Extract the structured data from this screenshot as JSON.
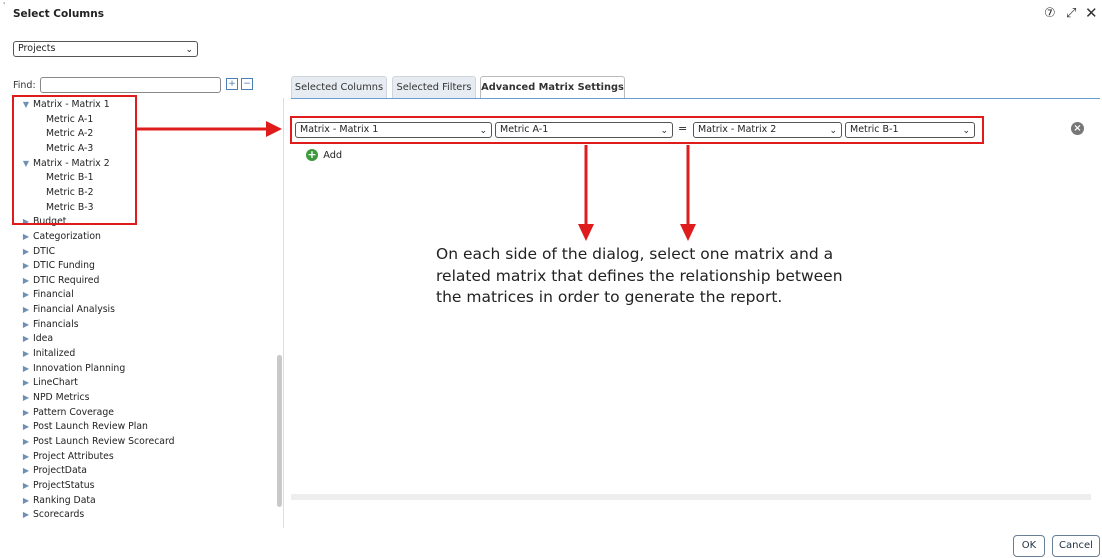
{
  "dialog": {
    "title": "Select Columns",
    "help_icon": "help-circle-icon",
    "expand_icon": "expand-icon",
    "close_icon": "close-icon",
    "help_glyph": "⑦",
    "expand_glyph": "⤢",
    "close_glyph": "✕"
  },
  "entity_select": {
    "value": "Projects"
  },
  "find": {
    "label": "Find:",
    "value": ""
  },
  "tree": {
    "items": [
      {
        "label": "Matrix - Matrix 1",
        "expanded": true,
        "level": 0
      },
      {
        "label": "Metric A-1",
        "level": 1
      },
      {
        "label": "Metric A-2",
        "level": 1
      },
      {
        "label": "Metric A-3",
        "level": 1
      },
      {
        "label": "Matrix - Matrix 2",
        "expanded": true,
        "level": 0
      },
      {
        "label": "Metric B-1",
        "level": 1
      },
      {
        "label": "Metric B-2",
        "level": 1
      },
      {
        "label": "Metric B-3",
        "level": 1
      },
      {
        "label": "Budget",
        "level": 0
      },
      {
        "label": "Categorization",
        "level": 0
      },
      {
        "label": "DTIC",
        "level": 0
      },
      {
        "label": "DTIC Funding",
        "level": 0
      },
      {
        "label": "DTIC Required",
        "level": 0
      },
      {
        "label": "Financial",
        "level": 0
      },
      {
        "label": "Financial Analysis",
        "level": 0
      },
      {
        "label": "Financials",
        "level": 0
      },
      {
        "label": "Idea",
        "level": 0
      },
      {
        "label": "Initalized",
        "level": 0
      },
      {
        "label": "Innovation Planning",
        "level": 0
      },
      {
        "label": "LineChart",
        "level": 0
      },
      {
        "label": "NPD Metrics",
        "level": 0
      },
      {
        "label": "Pattern Coverage",
        "level": 0
      },
      {
        "label": "Post Launch Review Plan",
        "level": 0
      },
      {
        "label": "Post Launch Review Scorecard",
        "level": 0
      },
      {
        "label": "Project Attributes",
        "level": 0
      },
      {
        "label": "ProjectData",
        "level": 0
      },
      {
        "label": "ProjectStatus",
        "level": 0
      },
      {
        "label": "Ranking Data",
        "level": 0
      },
      {
        "label": "Scorecards",
        "level": 0
      }
    ]
  },
  "tabs": [
    {
      "label": "Selected Columns",
      "active": false
    },
    {
      "label": "Selected Filters",
      "active": false
    },
    {
      "label": "Advanced Matrix Settings",
      "active": true
    }
  ],
  "matrix_row": {
    "left_matrix": "Matrix - Matrix 1",
    "left_metric": "Metric A-1",
    "equals": "=",
    "right_matrix": "Matrix - Matrix 2",
    "right_metric": "Metric B-1"
  },
  "add": {
    "label": "Add"
  },
  "annotation": "On each side of the dialog, select one matrix and a related matrix that defines the relationship between the matrices in order to generate the report.",
  "footer": {
    "ok_label": "OK",
    "cancel_label": "Cancel"
  },
  "colors": {
    "highlight": "#e01b1b",
    "tab_accent": "#6b9bcf",
    "add_green": "#3c9a3c"
  }
}
